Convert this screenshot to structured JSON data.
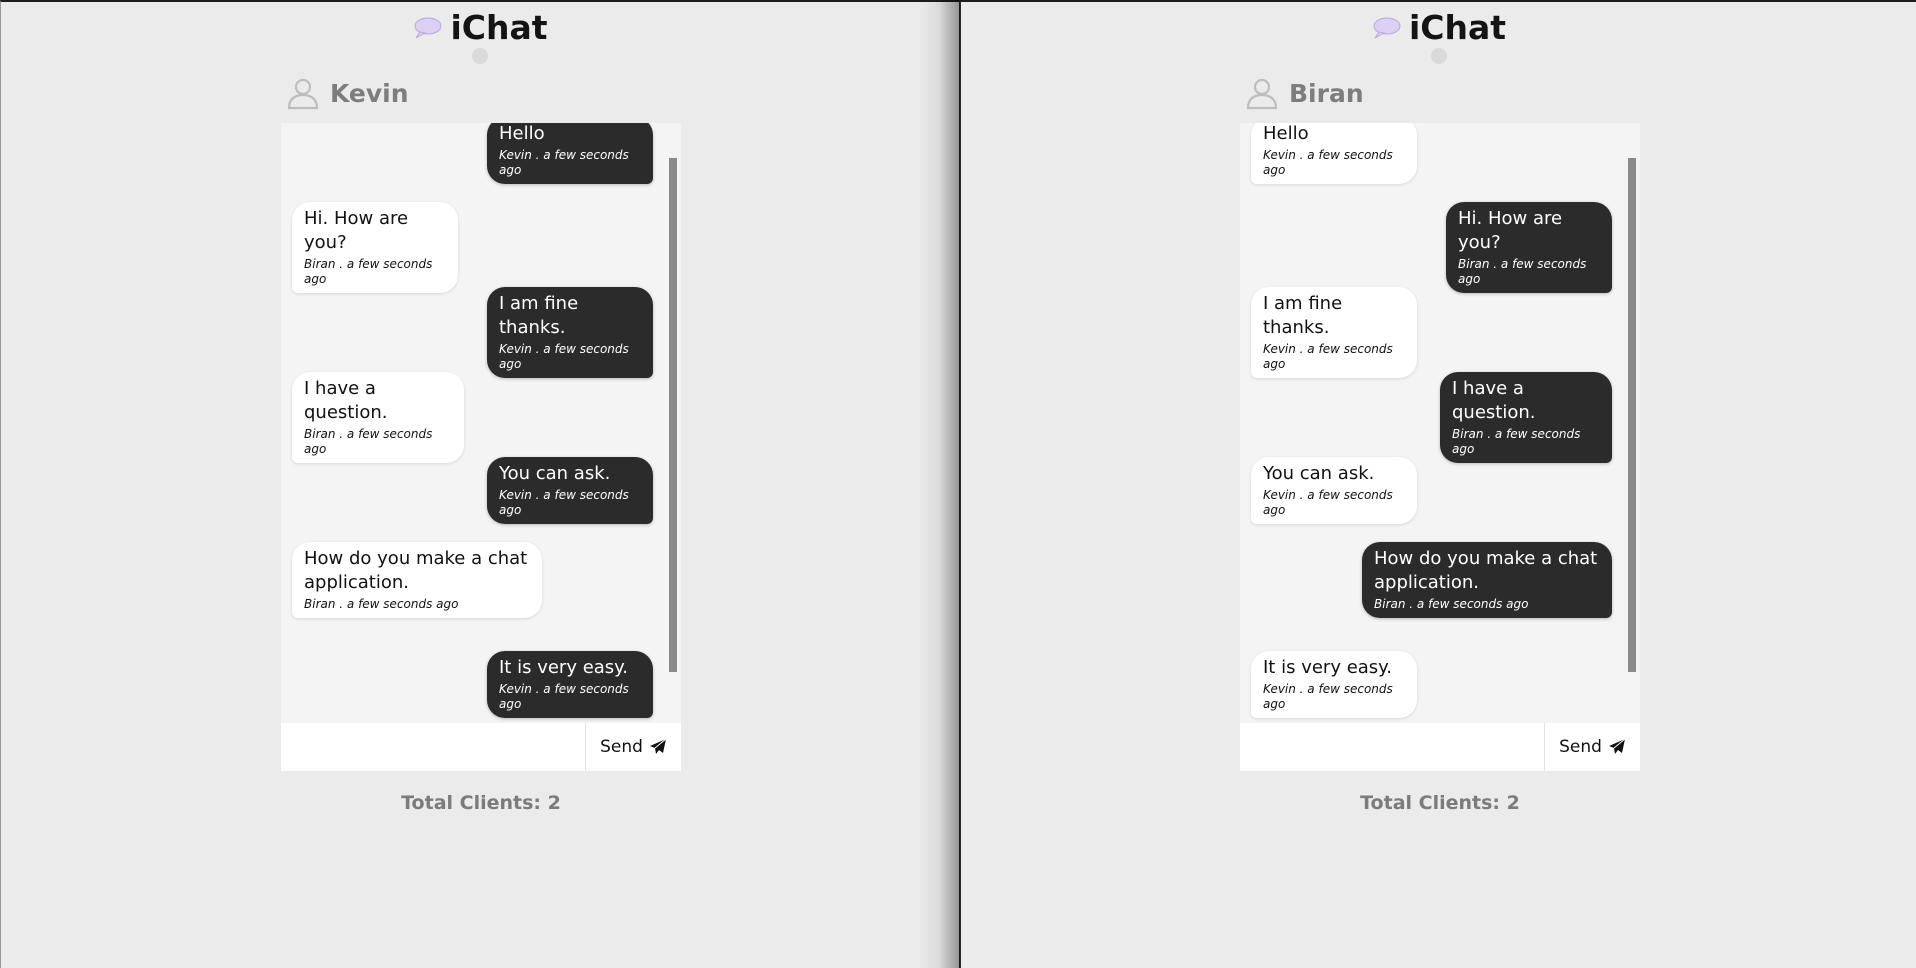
{
  "app": {
    "title": "iChat",
    "send_label": "Send",
    "total_clients_label": "Total Clients: 2",
    "colors": {
      "background": "#ebebeb",
      "panel": "#f4f4f4",
      "own_bubble": "#2b2b2b",
      "other_bubble": "#ffffff",
      "username": "#7d7d7d"
    }
  },
  "windows": [
    {
      "user": "Kevin",
      "input_value": "",
      "messages": [
        {
          "text": "Hello",
          "meta": "Kevin . a few seconds ago",
          "own": true
        },
        {
          "text": "Hi. How are you?",
          "meta": "Biran . a few seconds ago",
          "own": false
        },
        {
          "text": "I am fine thanks.",
          "meta": "Kevin . a few seconds ago",
          "own": true
        },
        {
          "text": "I have a question.",
          "meta": "Biran . a few seconds ago",
          "own": false
        },
        {
          "text": "You can ask.",
          "meta": "Kevin . a few seconds ago",
          "own": true
        },
        {
          "text": "How do you make a chat\napplication.",
          "meta": "Biran . a few seconds ago",
          "own": false
        },
        {
          "text": "It is very easy.",
          "meta": "Kevin . a few seconds ago",
          "own": true
        }
      ]
    },
    {
      "user": "Biran",
      "input_value": "",
      "messages": [
        {
          "text": "Hello",
          "meta": "Kevin . a few seconds ago",
          "own": false
        },
        {
          "text": "Hi. How are you?",
          "meta": "Biran . a few seconds ago",
          "own": true
        },
        {
          "text": "I am fine thanks.",
          "meta": "Kevin . a few seconds ago",
          "own": false
        },
        {
          "text": "I have a question.",
          "meta": "Biran . a few seconds ago",
          "own": true
        },
        {
          "text": "You can ask.",
          "meta": "Kevin . a few seconds ago",
          "own": false
        },
        {
          "text": "How do you make a chat\napplication.",
          "meta": "Biran . a few seconds ago",
          "own": true
        },
        {
          "text": "It is very easy.",
          "meta": "Kevin . a few seconds ago",
          "own": false
        }
      ]
    }
  ]
}
